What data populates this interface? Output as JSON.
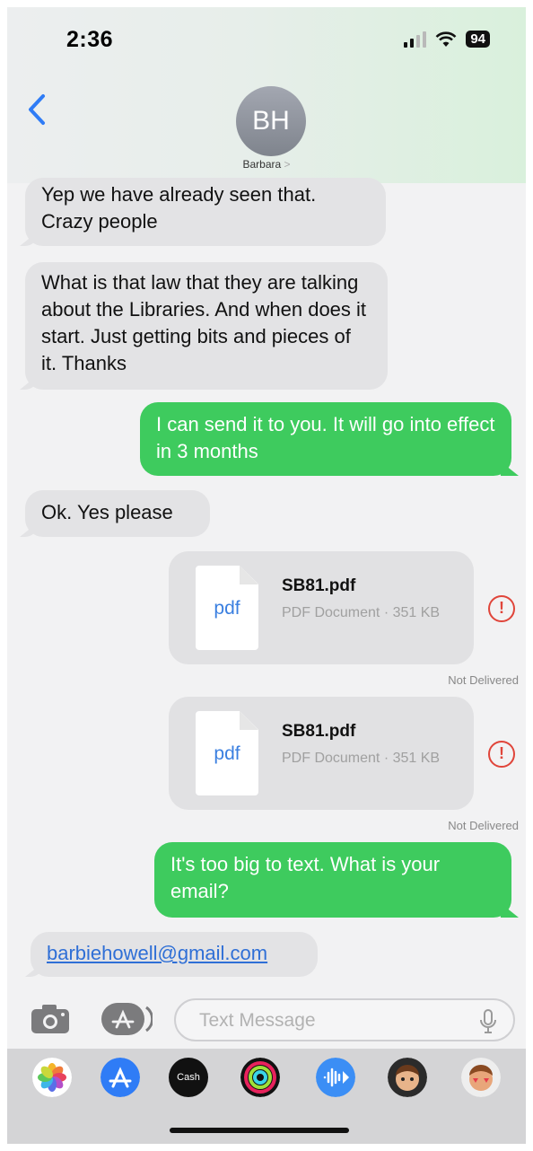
{
  "status_bar": {
    "time": "2:36",
    "battery": "94"
  },
  "header": {
    "avatar_initials": "BH",
    "contact_name": "Barbara",
    "contact_chevron": ">"
  },
  "messages": [
    {
      "text": "Yep we have already seen that. Crazy people"
    },
    {
      "text": "What is that law that they are talking about the Libraries. And when does it start. Just getting bits and pieces of it. Thanks"
    },
    {
      "text": "I can send it to you. It will go into effect in 3 months"
    },
    {
      "text": "Ok. Yes please"
    },
    {
      "text": "It's too big to text. What is your email?"
    },
    {
      "text": "barbiehowell@gmail.com"
    }
  ],
  "attachments": [
    {
      "icon_label": "pdf",
      "name": "SB81.pdf",
      "meta": "PDF Document · 351 KB",
      "error_symbol": "!",
      "status": "Not Delivered"
    },
    {
      "icon_label": "pdf",
      "name": "SB81.pdf",
      "meta": "PDF Document · 351 KB",
      "error_symbol": "!",
      "status": "Not Delivered"
    }
  ],
  "input": {
    "placeholder": "Text Message"
  },
  "app_drawer": {
    "apps": [
      {
        "icon": "photos-icon",
        "color": "#ffffff"
      },
      {
        "icon": "app-store-icon",
        "color": "#2f7cf6"
      },
      {
        "icon": "apple-cash-icon",
        "color": "#111111",
        "label": "Cash"
      },
      {
        "icon": "activity-icon",
        "color": "#111111"
      },
      {
        "icon": "audio-message-icon",
        "color": "#3b8ef5"
      },
      {
        "icon": "memoji-icon",
        "color": "#2b2b2b"
      },
      {
        "icon": "memoji-stickers-icon",
        "color": "#eeeeee"
      }
    ]
  },
  "colors": {
    "sent_bubble": "#3ecb5e",
    "received_bubble": "#e3e3e5",
    "link": "#2f6fd6",
    "error": "#e0453a"
  }
}
